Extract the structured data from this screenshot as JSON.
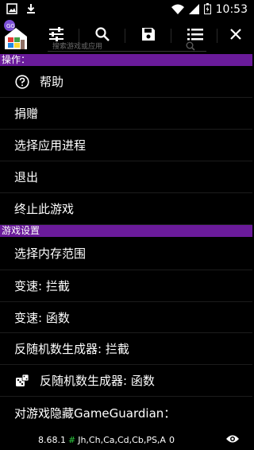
{
  "status_bar": {
    "time": "10:53",
    "left_icons": [
      "image-icon",
      "download-icon"
    ],
    "right_icons": [
      "wifi-icon",
      "signal-icon",
      "battery-icon"
    ]
  },
  "toolbar": {
    "search_placeholder": "搜索游戏或应用",
    "buttons": [
      "sliders-icon",
      "search-icon",
      "save-icon",
      "list-icon",
      "close-icon"
    ]
  },
  "sections": {
    "operations": "操作：",
    "game_settings": "游戏设置"
  },
  "operations_items": [
    {
      "label": "帮助",
      "icon": "help-circle-icon"
    },
    {
      "label": "捐赠"
    },
    {
      "label": "选择应用进程"
    },
    {
      "label": "退出"
    },
    {
      "label": "终止此游戏"
    }
  ],
  "settings_items": [
    {
      "label": "选择内存范围"
    },
    {
      "label": "变速: 拦截"
    },
    {
      "label": "变速: 函数"
    },
    {
      "label": "反随机数生成器: 拦截"
    },
    {
      "label": "反随机数生成器: 函数",
      "icon": "dice-icon"
    },
    {
      "label": "对游戏隐藏GameGuardian："
    }
  ],
  "footer": {
    "version": "8.68.1",
    "hash": "#",
    "modes": "Jh,Ch,Ca,Cd,Cb,PS,A",
    "count": "0"
  },
  "colors": {
    "section_bg": "#6a1b9a",
    "hash_color": "#2ecc40",
    "background": "#000000"
  }
}
